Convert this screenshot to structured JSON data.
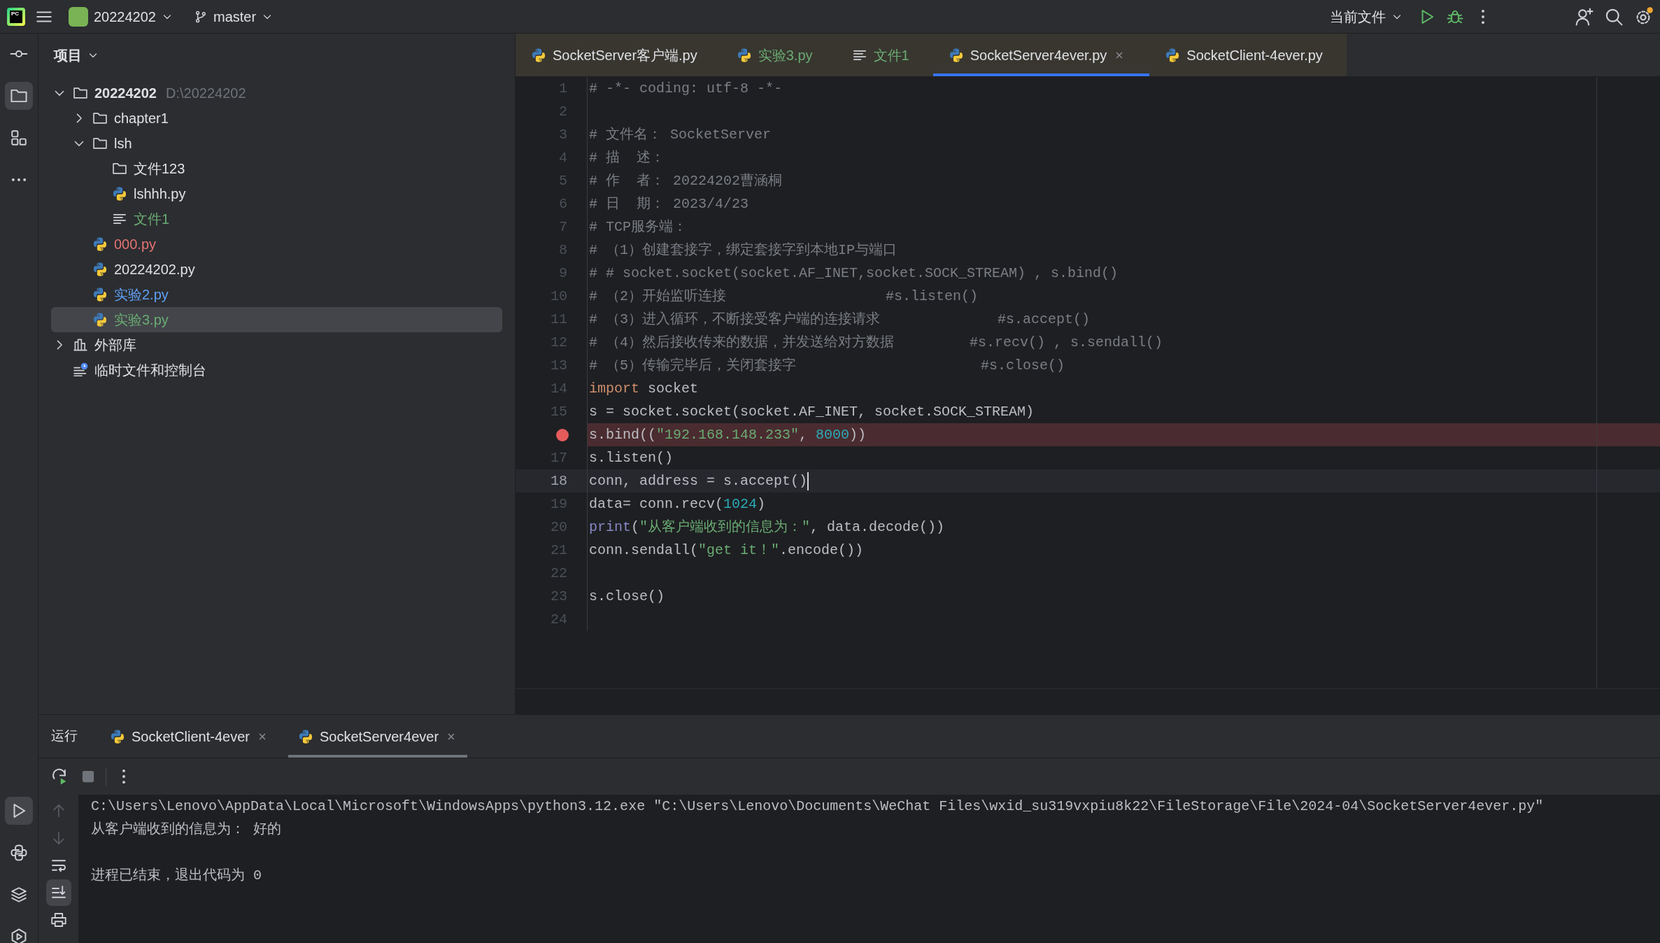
{
  "title_bar": {
    "logo": "PC",
    "project": "20224202",
    "branch": "master",
    "run_config": "当前文件"
  },
  "left_toolbar": [
    {
      "kind": "commit",
      "selected": false
    },
    {
      "kind": "folder",
      "selected": true
    },
    {
      "kind": "structure",
      "selected": false
    },
    {
      "kind": "more",
      "selected": false
    }
  ],
  "left_toolbar_bottom": [
    {
      "kind": "run",
      "selected": true
    },
    {
      "kind": "python",
      "selected": false
    },
    {
      "kind": "layers",
      "selected": false
    },
    {
      "kind": "services",
      "selected": false
    }
  ],
  "project_panel": {
    "title": "项目",
    "tree": [
      {
        "label": "20224202",
        "path": "D:\\20224202",
        "kind": "folder",
        "expanded": true,
        "selected": false,
        "color": "#dfe1e5",
        "children": [
          {
            "label": "chapter1",
            "kind": "folder",
            "expanded": false,
            "selected": false,
            "color": "#dfe1e5"
          },
          {
            "label": "lsh",
            "kind": "folder",
            "expanded": true,
            "selected": false,
            "color": "#dfe1e5",
            "children": [
              {
                "label": "文件123",
                "kind": "folder",
                "selected": false,
                "color": "#dfe1e5"
              },
              {
                "label": "lshhh.py",
                "kind": "python",
                "selected": false,
                "color": "#dfe1e5"
              },
              {
                "label": "文件1",
                "kind": "text",
                "selected": false,
                "color": "#6aab73"
              }
            ]
          },
          {
            "label": "000.py",
            "kind": "python",
            "selected": false,
            "color": "#e57373"
          },
          {
            "label": "20224202.py",
            "kind": "python",
            "selected": false,
            "color": "#dfe1e5"
          },
          {
            "label": "实验2.py",
            "kind": "python",
            "selected": false,
            "color": "#5f9ff5"
          },
          {
            "label": "实验3.py",
            "kind": "python",
            "selected": true,
            "color": "#6aab73"
          }
        ]
      },
      {
        "label": "外部库",
        "kind": "library",
        "expanded": false,
        "selected": false,
        "color": "#dfe1e5"
      },
      {
        "label": "临时文件和控制台",
        "kind": "scratch",
        "selected": false,
        "color": "#dfe1e5"
      }
    ]
  },
  "editor_tabs": [
    {
      "label": "SocketServer客户端.py",
      "kind": "python",
      "color": "#dfe1e5",
      "selected": false,
      "closable": false
    },
    {
      "label": "实验3.py",
      "kind": "python",
      "color": "#6aab73",
      "selected": false,
      "closable": false
    },
    {
      "label": "文件1",
      "kind": "text",
      "color": "#6aab73",
      "selected": false,
      "closable": false
    },
    {
      "label": "SocketServer4ever.py",
      "kind": "python",
      "color": "#dfe1e5",
      "selected": true,
      "closable": true
    },
    {
      "label": "SocketClient-4ever.py",
      "kind": "python",
      "color": "#dfe1e5",
      "selected": false,
      "closable": false
    }
  ],
  "lines": [
    {
      "number": "1",
      "breakpoint": false,
      "current": false,
      "segments": [
        {
          "kind": "comment",
          "text": "# -*- coding: utf-8 -*-"
        }
      ]
    },
    {
      "number": "2",
      "breakpoint": false,
      "current": false
    },
    {
      "number": "3",
      "breakpoint": false,
      "current": false,
      "segments": [
        {
          "kind": "comment",
          "text": "# 文件名： SocketServer"
        }
      ]
    },
    {
      "number": "4",
      "breakpoint": false,
      "current": false,
      "segments": [
        {
          "kind": "comment",
          "text": "# 描  述："
        }
      ]
    },
    {
      "number": "5",
      "breakpoint": false,
      "current": false,
      "segments": [
        {
          "kind": "comment",
          "text": "# 作  者： 20224202曹涵桐"
        }
      ]
    },
    {
      "number": "6",
      "breakpoint": false,
      "current": false,
      "segments": [
        {
          "kind": "comment",
          "text": "# 日  期： 2023/4/23"
        }
      ]
    },
    {
      "number": "7",
      "breakpoint": false,
      "current": false,
      "segments": [
        {
          "kind": "comment",
          "text": "# TCP服务端："
        }
      ]
    },
    {
      "number": "8",
      "breakpoint": false,
      "current": false,
      "segments": [
        {
          "kind": "comment",
          "text": "# （1）创建套接字，绑定套接字到本地IP与端口"
        }
      ]
    },
    {
      "number": "9",
      "breakpoint": false,
      "current": false,
      "segments": [
        {
          "kind": "comment",
          "text": "# # socket.socket(socket.AF_INET,socket.SOCK_STREAM) , s.bind()"
        }
      ]
    },
    {
      "number": "10",
      "breakpoint": false,
      "current": false,
      "segments": [
        {
          "kind": "comment",
          "text": "# （2）开始监听连接                   #s.listen()"
        }
      ]
    },
    {
      "number": "11",
      "breakpoint": false,
      "current": false,
      "segments": [
        {
          "kind": "comment",
          "text": "# （3）进入循环，不断接受客户端的连接请求              #s.accept()"
        }
      ]
    },
    {
      "number": "12",
      "breakpoint": false,
      "current": false,
      "segments": [
        {
          "kind": "comment",
          "text": "# （4）然后接收传来的数据，并发送给对方数据         #s.recv() , s.sendall()"
        }
      ]
    },
    {
      "number": "13",
      "breakpoint": false,
      "current": false,
      "segments": [
        {
          "kind": "comment",
          "text": "# （5）传输完毕后，关闭套接字                      #s.close()"
        }
      ]
    },
    {
      "number": "14",
      "breakpoint": false,
      "current": false,
      "segments": [
        {
          "kind": "keyword",
          "text": "import"
        },
        {
          "kind": "plain",
          "text": " socket"
        }
      ]
    },
    {
      "number": "15",
      "breakpoint": false,
      "current": false,
      "segments": [
        {
          "kind": "plain",
          "text": "s = socket.socket(socket.AF_INET, socket.SOCK_STREAM)"
        }
      ]
    },
    {
      "breakpoint": true,
      "current": false,
      "segments": [
        {
          "kind": "plain",
          "text": "s.bind(("
        },
        {
          "kind": "string",
          "text": "\"192.168.148.233\""
        },
        {
          "kind": "plain",
          "text": ", "
        },
        {
          "kind": "number",
          "text": "8000"
        },
        {
          "kind": "plain",
          "text": "))"
        }
      ]
    },
    {
      "number": "17",
      "breakpoint": false,
      "current": false,
      "segments": [
        {
          "kind": "plain",
          "text": "s.listen()"
        }
      ]
    },
    {
      "number": "18",
      "breakpoint": false,
      "current": true,
      "segments": [
        {
          "kind": "plain",
          "text": "conn, address = s.accept()"
        }
      ]
    },
    {
      "number": "19",
      "breakpoint": false,
      "current": false,
      "segments": [
        {
          "kind": "plain",
          "text": "data= conn.recv("
        },
        {
          "kind": "number",
          "text": "1024"
        },
        {
          "kind": "plain",
          "text": ")"
        }
      ]
    },
    {
      "number": "20",
      "breakpoint": false,
      "current": false,
      "segments": [
        {
          "kind": "builtin",
          "text": "print"
        },
        {
          "kind": "plain",
          "text": "("
        },
        {
          "kind": "string",
          "text": "\"从客户端收到的信息为：\""
        },
        {
          "kind": "plain",
          "text": ", data.decode())"
        }
      ]
    },
    {
      "number": "21",
      "breakpoint": false,
      "current": false,
      "segments": [
        {
          "kind": "plain",
          "text": "conn.sendall("
        },
        {
          "kind": "string",
          "text": "\"get it！\""
        },
        {
          "kind": "plain",
          "text": ".encode())"
        }
      ]
    },
    {
      "number": "22",
      "breakpoint": false,
      "current": false
    },
    {
      "number": "23",
      "breakpoint": false,
      "current": false,
      "segments": [
        {
          "kind": "plain",
          "text": "s.close()"
        }
      ]
    },
    {
      "number": "24",
      "breakpoint": false,
      "current": false
    }
  ],
  "run_panel": {
    "title": "运行",
    "tabs": [
      {
        "label": "SocketClient-4ever",
        "selected": false
      },
      {
        "label": "SocketServer4ever",
        "selected": true
      }
    ],
    "side_tools": [
      {
        "kind": "up",
        "disabled": true,
        "selected": false
      },
      {
        "kind": "down",
        "disabled": true,
        "selected": false
      },
      {
        "kind": "wrap",
        "disabled": false,
        "selected": false
      },
      {
        "kind": "scroll-end",
        "disabled": false,
        "selected": true
      },
      {
        "kind": "print",
        "disabled": false,
        "selected": false
      }
    ],
    "console": [
      {
        "kind": "text",
        "text": "C:\\Users\\Lenovo\\AppData\\Local\\Microsoft\\WindowsApps\\python3.12.exe \"C:\\Users\\Lenovo\\Documents\\WeChat Files\\wxid_su319vxpiu8k22\\FileStorage\\File\\2024-04\\SocketServer4ever.py\""
      },
      {
        "kind": "text",
        "text": "从客户端收到的信息为： 好的"
      },
      {
        "kind": "blank"
      },
      {
        "kind": "text",
        "text": "进程已结束，退出代码为 0"
      }
    ]
  }
}
